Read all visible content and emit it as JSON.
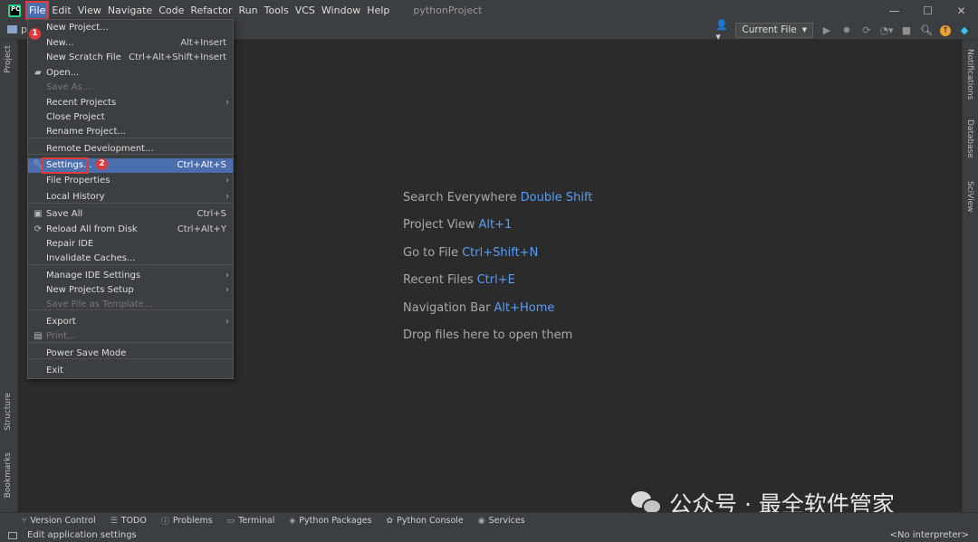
{
  "app": {
    "logo_text": "PC",
    "project_title": "pythonProject"
  },
  "menubar": [
    "File",
    "Edit",
    "View",
    "Navigate",
    "Code",
    "Refactor",
    "Run",
    "Tools",
    "VCS",
    "Window",
    "Help"
  ],
  "window_controls": {
    "minimize": "—",
    "maximize": "☐",
    "close": "✕"
  },
  "toolbar": {
    "crumb": "py",
    "run_config": "Current File"
  },
  "file_menu": [
    {
      "label": "New Project...",
      "shortcut": "",
      "submenu": false,
      "disabled": false,
      "icon": ""
    },
    {
      "label": "New...",
      "shortcut": "Alt+Insert",
      "submenu": false,
      "disabled": false,
      "icon": ""
    },
    {
      "label": "New Scratch File",
      "shortcut": "Ctrl+Alt+Shift+Insert",
      "submenu": false,
      "disabled": false,
      "icon": ""
    },
    {
      "label": "Open...",
      "shortcut": "",
      "submenu": false,
      "disabled": false,
      "icon": "folder-icon"
    },
    {
      "label": "Save As...",
      "shortcut": "",
      "submenu": false,
      "disabled": true,
      "icon": ""
    },
    {
      "label": "Recent Projects",
      "shortcut": "",
      "submenu": true,
      "disabled": false,
      "icon": ""
    },
    {
      "label": "Close Project",
      "shortcut": "",
      "submenu": false,
      "disabled": false,
      "icon": ""
    },
    {
      "label": "Rename Project...",
      "shortcut": "",
      "submenu": false,
      "disabled": false,
      "icon": ""
    },
    {
      "label": "Remote Development...",
      "shortcut": "",
      "submenu": false,
      "disabled": false,
      "icon": ""
    },
    {
      "label": "Settings...",
      "shortcut": "Ctrl+Alt+S",
      "submenu": false,
      "disabled": false,
      "icon": "wrench-icon"
    },
    {
      "label": "File Properties",
      "shortcut": "",
      "submenu": true,
      "disabled": false,
      "icon": ""
    },
    {
      "label": "Local History",
      "shortcut": "",
      "submenu": true,
      "disabled": false,
      "icon": ""
    },
    {
      "label": "Save All",
      "shortcut": "Ctrl+S",
      "submenu": false,
      "disabled": false,
      "icon": "save-icon"
    },
    {
      "label": "Reload All from Disk",
      "shortcut": "Ctrl+Alt+Y",
      "submenu": false,
      "disabled": false,
      "icon": "reload-icon"
    },
    {
      "label": "Repair IDE",
      "shortcut": "",
      "submenu": false,
      "disabled": false,
      "icon": ""
    },
    {
      "label": "Invalidate Caches...",
      "shortcut": "",
      "submenu": false,
      "disabled": false,
      "icon": ""
    },
    {
      "label": "Manage IDE Settings",
      "shortcut": "",
      "submenu": true,
      "disabled": false,
      "icon": ""
    },
    {
      "label": "New Projects Setup",
      "shortcut": "",
      "submenu": true,
      "disabled": false,
      "icon": ""
    },
    {
      "label": "Save File as Template...",
      "shortcut": "",
      "submenu": false,
      "disabled": true,
      "icon": ""
    },
    {
      "label": "Export",
      "shortcut": "",
      "submenu": true,
      "disabled": false,
      "icon": ""
    },
    {
      "label": "Print...",
      "shortcut": "",
      "submenu": false,
      "disabled": true,
      "icon": "print-icon"
    },
    {
      "label": "Power Save Mode",
      "shortcut": "",
      "submenu": false,
      "disabled": false,
      "icon": ""
    },
    {
      "label": "Exit",
      "shortcut": "",
      "submenu": false,
      "disabled": false,
      "icon": ""
    }
  ],
  "annotations": {
    "badge_1": "1",
    "badge_2": "2"
  },
  "hints": [
    {
      "text": "Search Everywhere",
      "key": "Double Shift"
    },
    {
      "text": "Project View",
      "key": "Alt+1"
    },
    {
      "text": "Go to File",
      "key": "Ctrl+Shift+N"
    },
    {
      "text": "Recent Files",
      "key": "Ctrl+E"
    },
    {
      "text": "Navigation Bar",
      "key": "Alt+Home"
    },
    {
      "text": "Drop files here to open them",
      "key": ""
    }
  ],
  "left_tabs": [
    "Project",
    "Structure",
    "Bookmarks"
  ],
  "right_tabs": [
    "Notifications",
    "Database",
    "SciView"
  ],
  "bottom_tabs": [
    {
      "label": "Version Control",
      "icon": "branch-icon"
    },
    {
      "label": "TODO",
      "icon": "list-icon"
    },
    {
      "label": "Problems",
      "icon": "info-icon"
    },
    {
      "label": "Terminal",
      "icon": "terminal-icon"
    },
    {
      "label": "Python Packages",
      "icon": "packages-icon"
    },
    {
      "label": "Python Console",
      "icon": "python-icon"
    },
    {
      "label": "Services",
      "icon": "services-icon"
    }
  ],
  "status": {
    "message": "Edit application settings",
    "interpreter": "<No interpreter>"
  },
  "watermark": "公众号 · 最全软件管家",
  "colors": {
    "accent": "#4b6eaf",
    "highlight": "#e03a3a",
    "key_blue": "#589df6",
    "background": "#2b2b2b",
    "panel": "#3c3f41"
  }
}
